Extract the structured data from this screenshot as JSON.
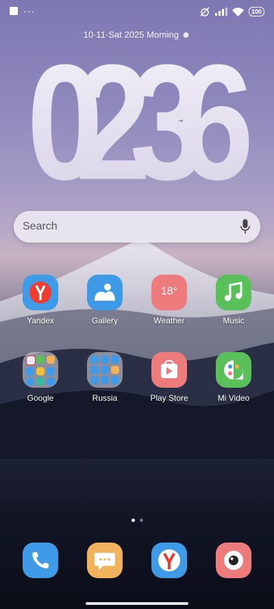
{
  "status": {
    "battery": "100"
  },
  "date_line": "10·11·Sat  2025  Morning ☻",
  "clock": {
    "digits": [
      "0",
      "2",
      "3",
      "6"
    ]
  },
  "search": {
    "placeholder": "Search"
  },
  "apps_row1": [
    {
      "label": "Yandex",
      "color": "#3f9ae8"
    },
    {
      "label": "Gallery",
      "color": "#3e9ae6"
    },
    {
      "label": "Weather",
      "color": "#ee7b7c",
      "temp": "18°"
    },
    {
      "label": "Music",
      "color": "#5ac15a"
    }
  ],
  "apps_row2": [
    {
      "label": "Google"
    },
    {
      "label": "Russia"
    },
    {
      "label": "Play Store",
      "color": "#ee7b7c"
    },
    {
      "label": "Mi Video",
      "color": "#5ac15a"
    }
  ],
  "dock": [
    {
      "name": "phone",
      "color": "#3f9ae8"
    },
    {
      "name": "messages",
      "color": "#f0b25a"
    },
    {
      "name": "yandex-browser",
      "color": "#3f9ae8"
    },
    {
      "name": "camera",
      "color": "#ee7b7c"
    }
  ],
  "page_indicator": {
    "current": 1,
    "total": 2
  }
}
